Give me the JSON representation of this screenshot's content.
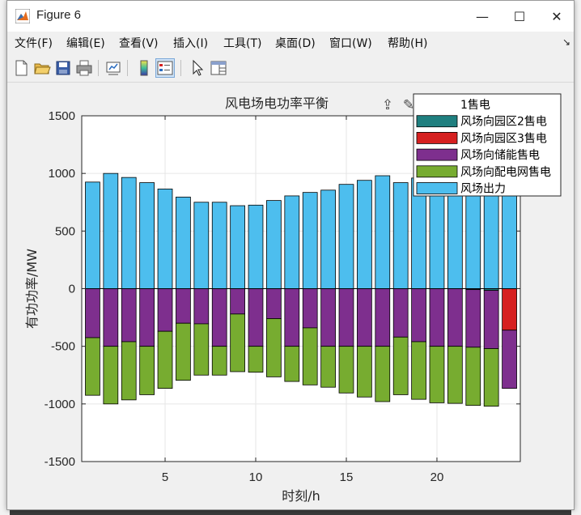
{
  "window": {
    "title": "Figure 6",
    "minimize_glyph": "—",
    "maximize_glyph": "☐",
    "close_glyph": "✕"
  },
  "menu": [
    {
      "label": "文件(F)"
    },
    {
      "label": "编辑(E)"
    },
    {
      "label": "查看(V)"
    },
    {
      "label": "插入(I)"
    },
    {
      "label": "工具(T)"
    },
    {
      "label": "桌面(D)"
    },
    {
      "label": "窗口(W)"
    },
    {
      "label": "帮助(H)"
    }
  ],
  "toolbar": {
    "icons": [
      "new-file-icon",
      "open-folder-icon",
      "save-icon",
      "print-icon",
      "link-plot-icon",
      "colorbar-icon",
      "legend-icon",
      "pointer-icon",
      "property-inspector-icon"
    ]
  },
  "axes_toolbar": {
    "icons": [
      "export-icon",
      "brush-icon",
      "data-tips-icon",
      "pan-icon",
      "zoom-in-icon",
      "zoom-out-icon",
      "home-icon"
    ]
  },
  "chart_data": {
    "type": "bar",
    "stacked": true,
    "title": "风电场电功率平衡",
    "xlabel": "时刻/h",
    "ylabel": "有功功率/MW",
    "xlim": [
      0.4,
      24.6
    ],
    "ylim": [
      -1500,
      1500
    ],
    "xticks": [
      5,
      10,
      15,
      20
    ],
    "yticks": [
      -1500,
      -1000,
      -500,
      0,
      500,
      1000,
      1500
    ],
    "grid": true,
    "legend_location": "northeast",
    "x": [
      1,
      2,
      3,
      4,
      5,
      6,
      7,
      8,
      9,
      10,
      11,
      12,
      13,
      14,
      15,
      16,
      17,
      18,
      19,
      20,
      21,
      22,
      23,
      24
    ],
    "series": [
      {
        "name": "1售电",
        "color": "#0072bd",
        "values": [
          0,
          0,
          0,
          0,
          0,
          0,
          0,
          0,
          0,
          0,
          0,
          0,
          0,
          0,
          0,
          0,
          0,
          0,
          0,
          0,
          0,
          0,
          0,
          0
        ]
      },
      {
        "name": "风场向园区2售电",
        "color": "#1f7f7f",
        "values": [
          0,
          0,
          0,
          0,
          0,
          0,
          0,
          0,
          0,
          0,
          0,
          0,
          0,
          0,
          0,
          0,
          0,
          0,
          0,
          0,
          0,
          -8,
          -15,
          0
        ]
      },
      {
        "name": "风场向园区3售电",
        "color": "#d62020",
        "values": [
          0,
          0,
          0,
          0,
          0,
          0,
          0,
          0,
          0,
          0,
          0,
          0,
          0,
          0,
          0,
          0,
          0,
          0,
          0,
          0,
          0,
          0,
          0,
          -360
        ]
      },
      {
        "name": "风场向储能售电",
        "color": "#7e2f8e",
        "values": [
          -425,
          -500,
          -460,
          -500,
          -370,
          -300,
          -305,
          -500,
          -220,
          -500,
          -260,
          -500,
          -340,
          -500,
          -500,
          -500,
          -500,
          -420,
          -460,
          -500,
          -500,
          -500,
          -505,
          -505
        ]
      },
      {
        "name": "风场向配电网售电",
        "color": "#77ac30",
        "values": [
          -500,
          -500,
          -505,
          -420,
          -495,
          -495,
          -445,
          -250,
          -500,
          -225,
          -505,
          -305,
          -495,
          -355,
          -405,
          -440,
          -480,
          -500,
          -500,
          -490,
          -495,
          -505,
          -500,
          0
        ]
      },
      {
        "name": "风场出力",
        "color": "#4dbeee",
        "values": [
          925,
          1000,
          965,
          920,
          865,
          795,
          750,
          750,
          720,
          725,
          765,
          805,
          835,
          855,
          905,
          940,
          980,
          920,
          960,
          990,
          995,
          1010,
          1020,
          865
        ]
      }
    ]
  }
}
